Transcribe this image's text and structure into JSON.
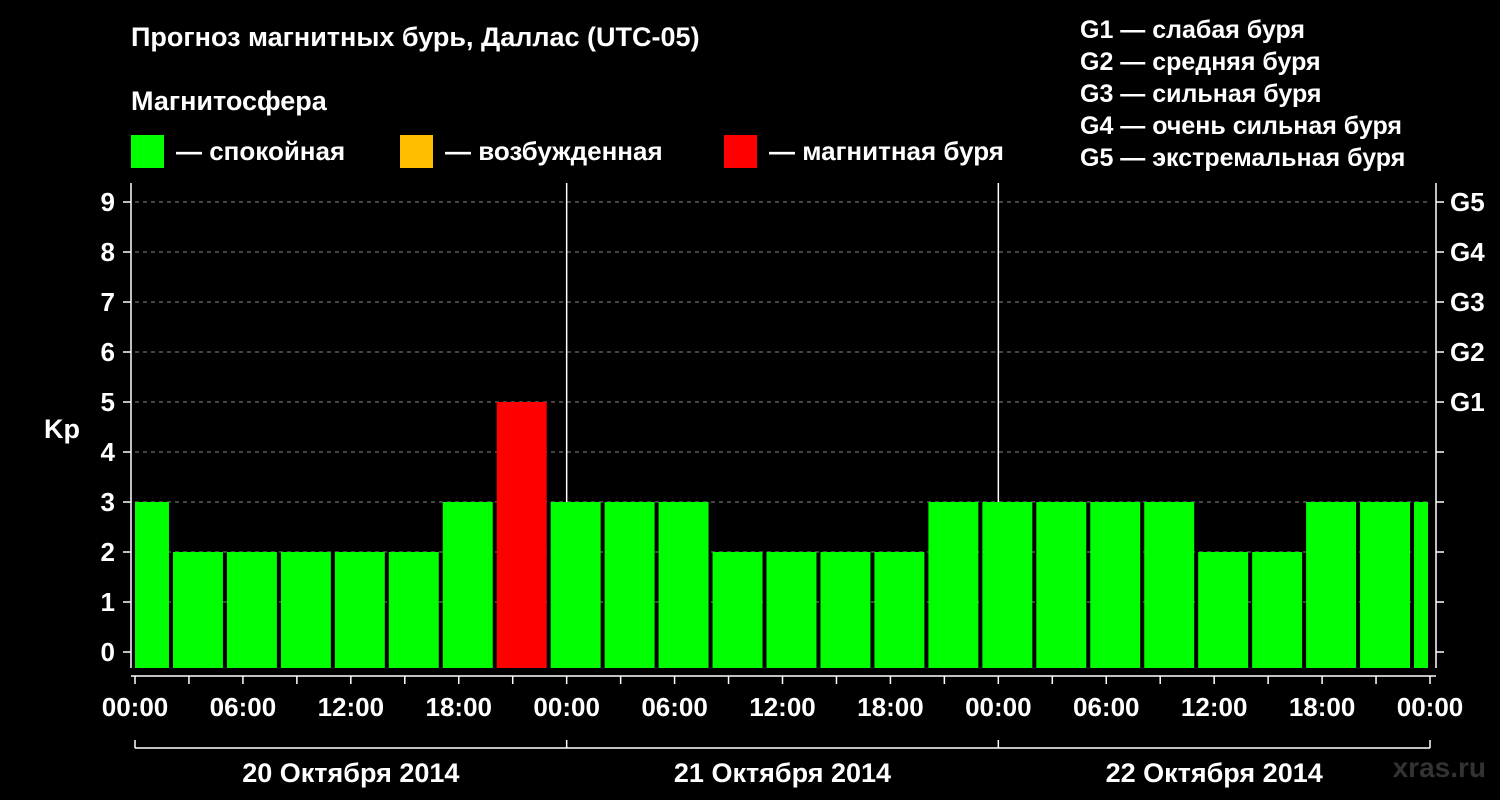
{
  "header": {
    "title": "Прогноз магнитных бурь, Даллас (UTC-05)",
    "subtitle": "Магнитосфера"
  },
  "legend": [
    {
      "label": "— спокойная",
      "color": "#00ff00"
    },
    {
      "label": "— возбужденная",
      "color": "#ffbf00"
    },
    {
      "label": "— магнитная буря",
      "color": "#ff0000"
    }
  ],
  "g_legend": [
    "G1 — слабая буря",
    "G2 — средняя буря",
    "G3 — сильная буря",
    "G4 — очень сильная буря",
    "G5 — экстремальная буря"
  ],
  "watermark": "xras.ru",
  "chart_data": {
    "type": "bar",
    "ylabel": "Kp",
    "ylim": [
      0,
      9
    ],
    "yticks": [
      "0",
      "1",
      "2",
      "3",
      "4",
      "5",
      "6",
      "7",
      "8",
      "9"
    ],
    "g_levels": [
      {
        "label": "G1",
        "kp": 5
      },
      {
        "label": "G2",
        "kp": 6
      },
      {
        "label": "G3",
        "kp": 7
      },
      {
        "label": "G4",
        "kp": 8
      },
      {
        "label": "G5",
        "kp": 9
      }
    ],
    "xticks": [
      "00:00",
      "06:00",
      "12:00",
      "18:00",
      "00:00",
      "06:00",
      "12:00",
      "18:00",
      "00:00",
      "06:00",
      "12:00",
      "18:00",
      "00:00"
    ],
    "days": [
      "20 Октября 2014",
      "21 Октября 2014",
      "22 Октября 2014"
    ],
    "x_hours_start": -1,
    "bar_hours": 3,
    "first_bar_visible_from": 0,
    "values": [
      3,
      2,
      2,
      2,
      2,
      2,
      3,
      5,
      3,
      3,
      3,
      2,
      2,
      2,
      2,
      3,
      3,
      3,
      3,
      3,
      2,
      2,
      3,
      3,
      3
    ],
    "status_colors": {
      "quiet": "#00ff00",
      "disturbed": "#ffbf00",
      "storm": "#ff0000"
    },
    "grid": "dashed horizontal at each Kp; solid verticals at day boundaries"
  }
}
